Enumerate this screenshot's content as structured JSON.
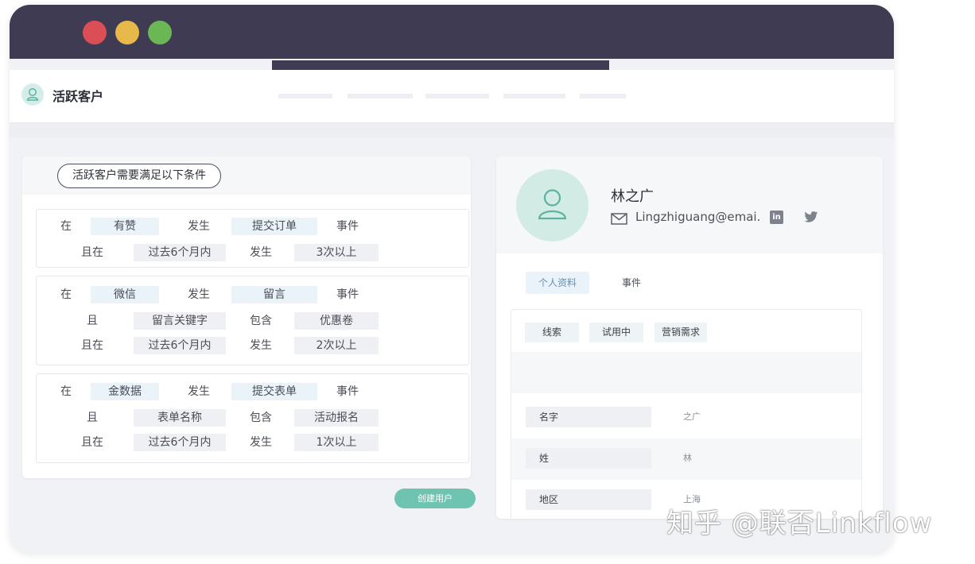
{
  "app": {
    "title": "活跃客户"
  },
  "conditions": {
    "header": "活跃客户需要满足以下条件",
    "rules": [
      {
        "rows": [
          [
            "在",
            "有赞",
            "发生",
            "提交订单",
            "事件"
          ],
          [
            "且在",
            "过去6个月内",
            "发生",
            "3次以上"
          ]
        ]
      },
      {
        "rows": [
          [
            "在",
            "微信",
            "发生",
            "留言",
            "事件"
          ],
          [
            "且",
            "留言关键字",
            "包含",
            "优惠卷"
          ],
          [
            "且在",
            "过去6个月内",
            "发生",
            "2次以上"
          ]
        ]
      },
      {
        "rows": [
          [
            "在",
            "金数据",
            "发生",
            "提交表单",
            "事件"
          ],
          [
            "且",
            "表单名称",
            "包含",
            "活动报名"
          ],
          [
            "且在",
            "过去6个月内",
            "发生",
            "1次以上"
          ]
        ]
      }
    ],
    "create_button": "创建用户"
  },
  "profile": {
    "name": "林之广",
    "email": "Lingzhiguang@emai.",
    "linkedin_label": "in",
    "tabs": {
      "info": "个人资料",
      "events": "事件"
    },
    "chips": {
      "lead": "线索",
      "trial": "试用中",
      "need": "营销需求"
    },
    "fields": [
      {
        "label": "名字",
        "value": "之广"
      },
      {
        "label": "姓",
        "value": "林"
      },
      {
        "label": "地区",
        "value": "上海"
      }
    ]
  },
  "watermark": "知乎 @联否Linkflow",
  "colors": {
    "titlebar": "#3f3b52",
    "accent": "#6fc3b1",
    "dot_red": "#dc4e55",
    "dot_yellow": "#e7b94b",
    "dot_green": "#6cb755"
  }
}
